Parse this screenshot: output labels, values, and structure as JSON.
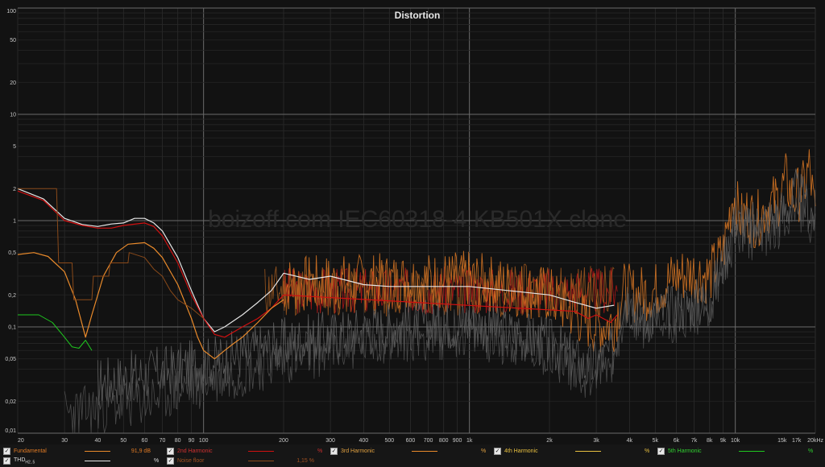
{
  "chart_data": {
    "type": "line",
    "title": "Distortion",
    "watermark": "boizoff.com IEC60318-4 KB501X clone",
    "x_scale": "log",
    "y_scale": "log",
    "xlim": [
      20,
      20000
    ],
    "ylim": [
      0.01,
      100
    ],
    "grid": true,
    "x_ticks": [
      {
        "v": 20,
        "label": "20"
      },
      {
        "v": 30,
        "label": "30"
      },
      {
        "v": 40,
        "label": "40"
      },
      {
        "v": 50,
        "label": "50"
      },
      {
        "v": 60,
        "label": "60"
      },
      {
        "v": 70,
        "label": "70"
      },
      {
        "v": 80,
        "label": "80"
      },
      {
        "v": 90,
        "label": "90"
      },
      {
        "v": 100,
        "label": "100"
      },
      {
        "v": 200,
        "label": "200"
      },
      {
        "v": 300,
        "label": "300"
      },
      {
        "v": 400,
        "label": "400"
      },
      {
        "v": 500,
        "label": "500"
      },
      {
        "v": 600,
        "label": "600"
      },
      {
        "v": 700,
        "label": "700"
      },
      {
        "v": 800,
        "label": "800"
      },
      {
        "v": 900,
        "label": "900"
      },
      {
        "v": 1000,
        "label": "1k"
      },
      {
        "v": 2000,
        "label": "2k"
      },
      {
        "v": 3000,
        "label": "3k"
      },
      {
        "v": 4000,
        "label": "4k"
      },
      {
        "v": 5000,
        "label": "5k"
      },
      {
        "v": 6000,
        "label": "6k"
      },
      {
        "v": 7000,
        "label": "7k"
      },
      {
        "v": 8000,
        "label": "8k"
      },
      {
        "v": 9000,
        "label": "9k"
      },
      {
        "v": 10000,
        "label": "10k"
      },
      {
        "v": 15000,
        "label": "15k"
      },
      {
        "v": 17000,
        "label": "17k"
      },
      {
        "v": 20000,
        "label": "20kHz"
      }
    ],
    "y_ticks": [
      {
        "v": 100,
        "label": "100"
      },
      {
        "v": 50,
        "label": "50"
      },
      {
        "v": 20,
        "label": "20"
      },
      {
        "v": 10,
        "label": "10"
      },
      {
        "v": 5,
        "label": "5"
      },
      {
        "v": 2,
        "label": "2"
      },
      {
        "v": 1,
        "label": "1"
      },
      {
        "v": 0.5,
        "label": "0,5"
      },
      {
        "v": 0.2,
        "label": "0,2"
      },
      {
        "v": 0.1,
        "label": "0,1"
      },
      {
        "v": 0.05,
        "label": "0,05"
      },
      {
        "v": 0.02,
        "label": "0,02"
      },
      {
        "v": 0.01,
        "label": "0,01"
      }
    ],
    "series": [
      {
        "key": "thd",
        "color": "#e6e6e6",
        "width": 1.2,
        "points": [
          [
            20,
            2.0
          ],
          [
            25,
            1.6
          ],
          [
            30,
            1.05
          ],
          [
            35,
            0.92
          ],
          [
            40,
            0.88
          ],
          [
            45,
            0.93
          ],
          [
            50,
            0.95
          ],
          [
            55,
            1.05
          ],
          [
            60,
            1.05
          ],
          [
            65,
            0.95
          ],
          [
            70,
            0.8
          ],
          [
            80,
            0.45
          ],
          [
            90,
            0.22
          ],
          [
            100,
            0.12
          ],
          [
            110,
            0.09
          ],
          [
            120,
            0.1
          ],
          [
            140,
            0.13
          ],
          [
            160,
            0.17
          ],
          [
            180,
            0.22
          ],
          [
            200,
            0.32
          ],
          [
            250,
            0.28
          ],
          [
            300,
            0.3
          ],
          [
            400,
            0.25
          ],
          [
            500,
            0.24
          ],
          [
            700,
            0.24
          ],
          [
            1000,
            0.24
          ],
          [
            2000,
            0.2
          ],
          [
            2500,
            0.17
          ],
          [
            3000,
            0.15
          ],
          [
            3500,
            0.16
          ]
        ]
      },
      {
        "key": "h2",
        "color": "#d01010",
        "width": 1.2,
        "points": [
          [
            20,
            1.9
          ],
          [
            25,
            1.55
          ],
          [
            30,
            1.0
          ],
          [
            35,
            0.9
          ],
          [
            40,
            0.85
          ],
          [
            45,
            0.85
          ],
          [
            50,
            0.9
          ],
          [
            60,
            0.95
          ],
          [
            65,
            0.88
          ],
          [
            70,
            0.72
          ],
          [
            80,
            0.4
          ],
          [
            90,
            0.2
          ],
          [
            100,
            0.12
          ],
          [
            110,
            0.085
          ],
          [
            120,
            0.08
          ],
          [
            140,
            0.1
          ],
          [
            160,
            0.12
          ],
          [
            180,
            0.15
          ],
          [
            200,
            0.2
          ],
          [
            2500,
            0.14
          ],
          [
            2800,
            0.12
          ],
          [
            3000,
            0.13
          ],
          [
            3400,
            0.11
          ],
          [
            3600,
            0.13
          ]
        ]
      },
      {
        "key": "h3",
        "color": "#e98a2b",
        "width": 1.2,
        "points": [
          [
            20,
            0.48
          ],
          [
            23,
            0.5
          ],
          [
            26,
            0.46
          ],
          [
            30,
            0.33
          ],
          [
            33,
            0.18
          ],
          [
            36,
            0.08
          ],
          [
            38,
            0.13
          ],
          [
            42,
            0.3
          ],
          [
            47,
            0.5
          ],
          [
            52,
            0.6
          ],
          [
            60,
            0.62
          ],
          [
            65,
            0.55
          ],
          [
            70,
            0.45
          ],
          [
            80,
            0.25
          ],
          [
            90,
            0.12
          ],
          [
            95,
            0.08
          ],
          [
            100,
            0.06
          ],
          [
            110,
            0.05
          ],
          [
            120,
            0.06
          ],
          [
            130,
            0.07
          ],
          [
            140,
            0.08
          ],
          [
            160,
            0.11
          ],
          [
            180,
            0.15
          ],
          [
            200,
            0.18
          ]
        ]
      },
      {
        "key": "h5",
        "color": "#1fc81f",
        "width": 1.0,
        "points": [
          [
            20,
            0.13
          ],
          [
            24,
            0.13
          ],
          [
            27,
            0.11
          ],
          [
            30,
            0.08
          ],
          [
            32,
            0.065
          ],
          [
            34,
            0.063
          ],
          [
            36,
            0.075
          ],
          [
            38,
            0.06
          ]
        ]
      },
      {
        "key": "noise",
        "color": "#8a4a1a",
        "width": 1.0,
        "points": [
          [
            20,
            2.0
          ],
          [
            28,
            2.0
          ],
          [
            28.5,
            0.4
          ],
          [
            32,
            0.4
          ],
          [
            32.5,
            0.18
          ],
          [
            38,
            0.18
          ],
          [
            38.5,
            0.3
          ],
          [
            44,
            0.3
          ],
          [
            44.5,
            0.4
          ],
          [
            52,
            0.4
          ],
          [
            52.5,
            0.5
          ],
          [
            60,
            0.45
          ],
          [
            65,
            0.35
          ],
          [
            70,
            0.3
          ],
          [
            75,
            0.22
          ],
          [
            80,
            0.18
          ],
          [
            90,
            0.15
          ],
          [
            100,
            0.12
          ]
        ]
      }
    ],
    "noise_series": [
      {
        "key": "h2",
        "color": "#c41818",
        "width": 0.8,
        "start": 200,
        "end": 3600,
        "base": 0.22,
        "amp": 0.45,
        "seed": 3
      },
      {
        "key": "h3",
        "color": "#e07a24",
        "width": 0.9,
        "start": 200,
        "end": 20000,
        "base": 0.24,
        "amp": 0.55,
        "seed": 7,
        "anchors": [
          [
            200,
            0.25
          ],
          [
            1000,
            0.28
          ],
          [
            2000,
            0.2
          ],
          [
            2500,
            0.13
          ],
          [
            3000,
            0.1
          ],
          [
            3500,
            0.11
          ],
          [
            3800,
            0.22
          ],
          [
            4200,
            0.2
          ],
          [
            5000,
            0.22
          ],
          [
            6000,
            0.3
          ],
          [
            7000,
            0.32
          ],
          [
            8000,
            0.3
          ],
          [
            9000,
            0.5
          ],
          [
            9800,
            1.8
          ],
          [
            10500,
            1.0
          ],
          [
            11000,
            1.2
          ],
          [
            12000,
            1.0
          ],
          [
            13000,
            1.3
          ],
          [
            14500,
            1.6
          ],
          [
            15500,
            2.4
          ],
          [
            16500,
            1.6
          ],
          [
            18000,
            2.0
          ],
          [
            19000,
            3.2
          ],
          [
            20000,
            1.0
          ]
        ]
      },
      {
        "key": "noise",
        "color": "#a35a20",
        "width": 0.9,
        "start": 170,
        "end": 3500,
        "base": 0.22,
        "amp": 0.5,
        "seed": 11
      },
      {
        "key": "h4",
        "color": "#666666",
        "width": 0.8,
        "start": 40,
        "end": 20000,
        "base": 0.05,
        "amp": 0.5,
        "seed": 17,
        "anchors": [
          [
            40,
            0.03
          ],
          [
            100,
            0.045
          ],
          [
            200,
            0.07
          ],
          [
            500,
            0.1
          ],
          [
            1000,
            0.11
          ],
          [
            2000,
            0.07
          ],
          [
            2800,
            0.04
          ],
          [
            3500,
            0.06
          ],
          [
            3800,
            0.2
          ],
          [
            4500,
            0.12
          ],
          [
            6000,
            0.15
          ],
          [
            8000,
            0.18
          ],
          [
            9000,
            0.4
          ],
          [
            10000,
            1.0
          ],
          [
            11000,
            0.8
          ],
          [
            13000,
            1.0
          ],
          [
            15000,
            1.2
          ],
          [
            17000,
            1.8
          ],
          [
            20000,
            1.1
          ]
        ]
      },
      {
        "key": "h5",
        "color": "#555555",
        "width": 0.8,
        "start": 30,
        "end": 20000,
        "base": 0.03,
        "amp": 0.5,
        "seed": 23,
        "anchors": [
          [
            30,
            0.015
          ],
          [
            60,
            0.02
          ],
          [
            100,
            0.03
          ],
          [
            200,
            0.05
          ],
          [
            500,
            0.08
          ],
          [
            1000,
            0.09
          ],
          [
            2000,
            0.06
          ],
          [
            2800,
            0.035
          ],
          [
            3500,
            0.05
          ],
          [
            3800,
            0.15
          ],
          [
            4500,
            0.1
          ],
          [
            6000,
            0.12
          ],
          [
            8000,
            0.15
          ],
          [
            9500,
            0.5
          ],
          [
            10000,
            0.9
          ],
          [
            12000,
            0.7
          ],
          [
            15000,
            1.0
          ],
          [
            17000,
            1.5
          ],
          [
            20000,
            0.9
          ]
        ]
      }
    ],
    "legend": [
      {
        "name": "Fundamental",
        "value": "91,9 dB",
        "unit": "",
        "color": "#e98a2b",
        "name_color": "#e07a24"
      },
      {
        "name": "2nd Harmonic",
        "value": "",
        "unit": "%",
        "color": "#d01010",
        "name_color": "#d03030"
      },
      {
        "name": "3rd Harmonic",
        "value": "",
        "unit": "%",
        "color": "#e98a2b",
        "name_color": "#e0a040"
      },
      {
        "name": "4th Harmonic",
        "value": "",
        "unit": "%",
        "color": "#e8c040",
        "name_color": "#e8c040"
      },
      {
        "name": "5th Harmonic",
        "value": "",
        "unit": "%",
        "color": "#1fc81f",
        "name_color": "#30d030"
      },
      {
        "name": "THD",
        "sub": "H2..5",
        "value": "",
        "unit": "%",
        "color": "#e6e6e6",
        "name_color": "#dddddd"
      },
      {
        "name": "Noise floor",
        "value": "1,15 %",
        "unit": "",
        "color": "#8a4a1a",
        "name_color": "#a05020"
      }
    ]
  }
}
